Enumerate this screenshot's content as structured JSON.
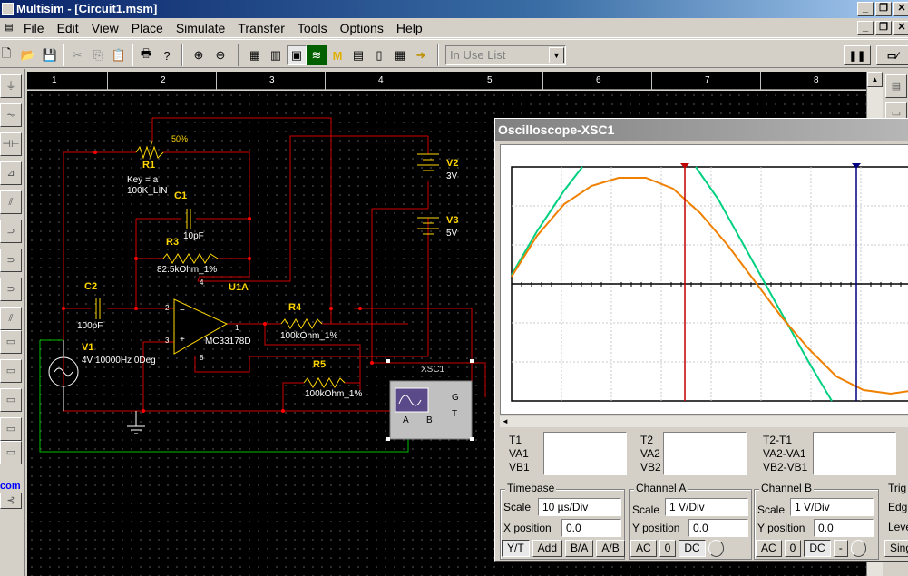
{
  "window": {
    "title": "Multisim - [Circuit1.msm]"
  },
  "menu": [
    "File",
    "Edit",
    "View",
    "Place",
    "Simulate",
    "Transfer",
    "Tools",
    "Options",
    "Help"
  ],
  "toolbar": {
    "in_use_list": "In Use List"
  },
  "ruler": [
    "1",
    "2",
    "3",
    "4",
    "5",
    "6",
    "7",
    "8"
  ],
  "components": {
    "r1": {
      "name": "R1",
      "key": "Key = a",
      "value": "100K_LIN",
      "pct": "50%"
    },
    "c1": {
      "name": "C1",
      "value": "10pF"
    },
    "r3": {
      "name": "R3",
      "value": "82.5kOhm_1%"
    },
    "c2": {
      "name": "C2",
      "value": "100pF"
    },
    "u1a": {
      "name": "U1A",
      "part": "MC33178D",
      "pins": [
        "2",
        "3",
        "4",
        "8",
        "1"
      ]
    },
    "r4": {
      "name": "R4",
      "value": "100kOhm_1%"
    },
    "r5": {
      "name": "R5",
      "value": "100kOhm_1%"
    },
    "v1": {
      "name": "V1",
      "value": "4V 10000Hz 0Deg"
    },
    "v2": {
      "name": "V2",
      "value": "3V"
    },
    "v3": {
      "name": "V3",
      "value": "5V"
    },
    "xsc1": {
      "name": "XSC1",
      "g": "G",
      "t": "T",
      "a": "A",
      "b": "B"
    }
  },
  "left_tools": {
    "com": "com"
  },
  "scope": {
    "title": "Oscilloscope-XSC1",
    "cursor_table": {
      "t1": [
        "T1",
        "VA1",
        "VB1"
      ],
      "t2": [
        "T2",
        "VA2",
        "VB2"
      ],
      "t21": [
        "T2-T1",
        "VA2-VA1",
        "VB2-VB1"
      ]
    },
    "timebase": {
      "title": "Timebase",
      "scale_label": "Scale",
      "scale": "10 µs/Div",
      "xpos_label": "X position",
      "xpos": "0.0",
      "buttons": [
        "Y/T",
        "Add",
        "B/A",
        "A/B"
      ]
    },
    "channel_a": {
      "title": "Channel A",
      "scale_label": "Scale",
      "scale": "1 V/Div",
      "ypos_label": "Y position",
      "ypos": "0.0",
      "buttons": [
        "AC",
        "0",
        "DC"
      ]
    },
    "channel_b": {
      "title": "Channel B",
      "scale_label": "Scale",
      "scale": "1 V/Div",
      "ypos_label": "Y position",
      "ypos": "0.0",
      "buttons": [
        "AC",
        "0",
        "DC",
        "-"
      ]
    },
    "trigger": {
      "title": "Trig",
      "edge": "Edg",
      "level": "Leve",
      "sing": "Sing."
    },
    "colors": {
      "channel_a": "#00d080",
      "channel_b": "#f08000",
      "cursor1": "#c00000",
      "cursor2": "#000080"
    }
  }
}
